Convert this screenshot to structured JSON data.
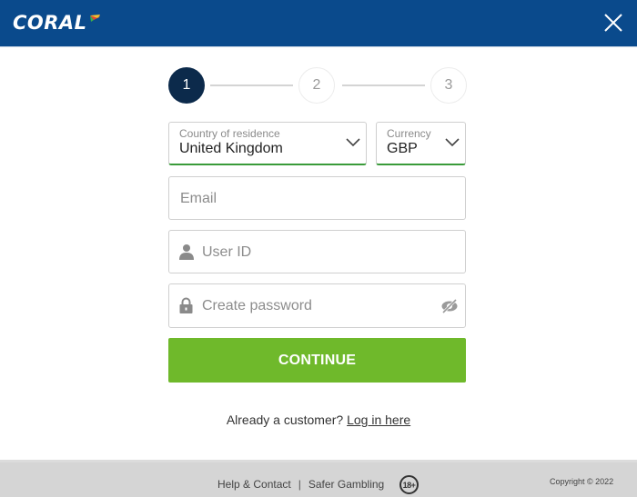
{
  "header": {
    "brand": "CORAL",
    "brand_color": "#0a4a8c",
    "close_icon": "close-icon"
  },
  "stepper": {
    "current_step": 1,
    "steps": [
      {
        "label": "1",
        "state": "active"
      },
      {
        "label": "2",
        "state": "inactive"
      },
      {
        "label": "3",
        "state": "inactive"
      }
    ],
    "active_color": "#0c2a4b"
  },
  "form": {
    "country": {
      "label": "Country of residence",
      "value": "United Kingdom"
    },
    "currency": {
      "label": "Currency",
      "value": "GBP"
    },
    "email": {
      "placeholder": "Email",
      "value": ""
    },
    "user_id": {
      "placeholder": "User ID",
      "value": "",
      "icon": "user-icon"
    },
    "password": {
      "placeholder": "Create password",
      "value": "",
      "icon": "lock-icon",
      "toggle_icon": "eye-slash-icon"
    },
    "continue_label": "CONTINUE",
    "continue_color": "#6fb92b",
    "valid_color": "#3a9b3a"
  },
  "login": {
    "prompt": "Already a customer?",
    "link_label": "Log in here"
  },
  "footer": {
    "help_label": "Help & Contact",
    "separator": "|",
    "safer_gambling_label": "Safer Gambling",
    "age_badge": "18+",
    "copyright": "Copyright © 2022"
  }
}
